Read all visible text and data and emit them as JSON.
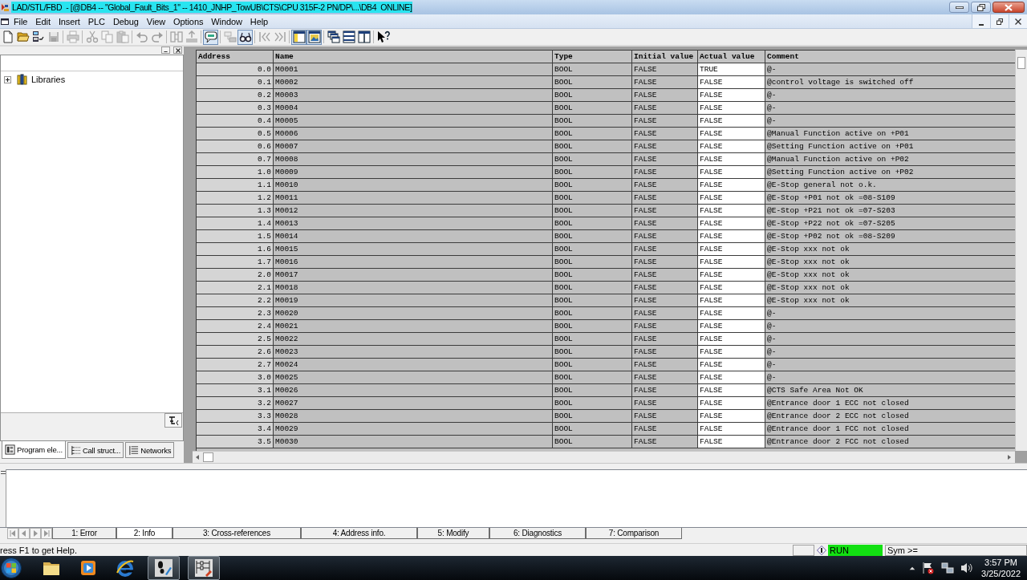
{
  "window": {
    "title": "LAD/STL/FBD  - [@DB4 -- \"Global_Fault_Bits_1\" -- 1410_JNHP_TowUB\\CTS\\CPU 315F-2 PN/DP\\...\\DB4  ONLINE]"
  },
  "menu": [
    "File",
    "Edit",
    "Insert",
    "PLC",
    "Debug",
    "View",
    "Options",
    "Window",
    "Help"
  ],
  "toolbar": {
    "groups": [
      [
        {
          "kind": "new",
          "disabled": false,
          "pressed": false
        },
        {
          "kind": "open",
          "disabled": false,
          "pressed": false
        },
        {
          "kind": "nodes",
          "disabled": false,
          "pressed": false
        },
        {
          "kind": "save",
          "disabled": true,
          "pressed": false
        }
      ],
      [
        {
          "kind": "print",
          "disabled": true,
          "pressed": false
        }
      ],
      [
        {
          "kind": "cut",
          "disabled": true,
          "pressed": false
        },
        {
          "kind": "copy",
          "disabled": true,
          "pressed": false
        },
        {
          "kind": "paste",
          "disabled": true,
          "pressed": false
        }
      ],
      [
        {
          "kind": "undo",
          "disabled": true,
          "pressed": false
        },
        {
          "kind": "redo",
          "disabled": true,
          "pressed": false
        }
      ],
      [
        {
          "kind": "blocks",
          "disabled": true,
          "pressed": false
        },
        {
          "kind": "load",
          "disabled": true,
          "pressed": false
        }
      ],
      [
        {
          "kind": "bubble",
          "disabled": false,
          "pressed": true
        }
      ],
      [
        {
          "kind": "stacked",
          "disabled": true,
          "pressed": false
        },
        {
          "kind": "glasses",
          "disabled": false,
          "pressed": true
        }
      ],
      [
        {
          "kind": "skip_back",
          "disabled": true,
          "pressed": false
        },
        {
          "kind": "skip_forward",
          "disabled": true,
          "pressed": false
        }
      ],
      [
        {
          "kind": "layout",
          "disabled": false,
          "pressed": true
        },
        {
          "kind": "picture",
          "disabled": false,
          "pressed": true
        }
      ],
      [
        {
          "kind": "cascade",
          "disabled": false,
          "pressed": false
        },
        {
          "kind": "tile_h",
          "disabled": false,
          "pressed": false
        },
        {
          "kind": "tile_v",
          "disabled": false,
          "pressed": false
        }
      ],
      [
        {
          "kind": "help",
          "disabled": false,
          "pressed": false
        }
      ]
    ]
  },
  "explorer": {
    "tree": [
      {
        "label": "Libraries",
        "expanded": false
      }
    ],
    "tabs": [
      {
        "label": "Program ele...",
        "kind": "program",
        "selected": true
      },
      {
        "label": "Call struct...",
        "kind": "call",
        "selected": false
      },
      {
        "label": "Networks",
        "kind": "networks",
        "selected": false
      }
    ]
  },
  "table": {
    "columns": [
      "Address",
      "Name",
      "Type",
      "Initial value",
      "Actual value",
      "Comment"
    ],
    "rows": [
      {
        "address": "0.0",
        "name": "M0001",
        "type": "BOOL",
        "initial_value": "FALSE",
        "actual_value": "TRUE",
        "comment": "@-"
      },
      {
        "address": "0.1",
        "name": "M0002",
        "type": "BOOL",
        "initial_value": "FALSE",
        "actual_value": "FALSE",
        "comment": "@control voltage is switched off"
      },
      {
        "address": "0.2",
        "name": "M0003",
        "type": "BOOL",
        "initial_value": "FALSE",
        "actual_value": "FALSE",
        "comment": "@-"
      },
      {
        "address": "0.3",
        "name": "M0004",
        "type": "BOOL",
        "initial_value": "FALSE",
        "actual_value": "FALSE",
        "comment": "@-"
      },
      {
        "address": "0.4",
        "name": "M0005",
        "type": "BOOL",
        "initial_value": "FALSE",
        "actual_value": "FALSE",
        "comment": "@-"
      },
      {
        "address": "0.5",
        "name": "M0006",
        "type": "BOOL",
        "initial_value": "FALSE",
        "actual_value": "FALSE",
        "comment": "@Manual Function active on +P01"
      },
      {
        "address": "0.6",
        "name": "M0007",
        "type": "BOOL",
        "initial_value": "FALSE",
        "actual_value": "FALSE",
        "comment": "@Setting Function active on +P01"
      },
      {
        "address": "0.7",
        "name": "M0008",
        "type": "BOOL",
        "initial_value": "FALSE",
        "actual_value": "FALSE",
        "comment": "@Manual Function active on +P02"
      },
      {
        "address": "1.0",
        "name": "M0009",
        "type": "BOOL",
        "initial_value": "FALSE",
        "actual_value": "FALSE",
        "comment": "@Setting Function active on +P02"
      },
      {
        "address": "1.1",
        "name": "M0010",
        "type": "BOOL",
        "initial_value": "FALSE",
        "actual_value": "FALSE",
        "comment": "@E-Stop general not o.k."
      },
      {
        "address": "1.2",
        "name": "M0011",
        "type": "BOOL",
        "initial_value": "FALSE",
        "actual_value": "FALSE",
        "comment": "@E-Stop +P01 not ok =08-S109"
      },
      {
        "address": "1.3",
        "name": "M0012",
        "type": "BOOL",
        "initial_value": "FALSE",
        "actual_value": "FALSE",
        "comment": "@E-Stop +P21 not ok =07-S203"
      },
      {
        "address": "1.4",
        "name": "M0013",
        "type": "BOOL",
        "initial_value": "FALSE",
        "actual_value": "FALSE",
        "comment": "@E-Stop +P22 not ok =07-S205"
      },
      {
        "address": "1.5",
        "name": "M0014",
        "type": "BOOL",
        "initial_value": "FALSE",
        "actual_value": "FALSE",
        "comment": "@E-Stop +P02 not ok =08-S209"
      },
      {
        "address": "1.6",
        "name": "M0015",
        "type": "BOOL",
        "initial_value": "FALSE",
        "actual_value": "FALSE",
        "comment": "@E-Stop xxx not ok"
      },
      {
        "address": "1.7",
        "name": "M0016",
        "type": "BOOL",
        "initial_value": "FALSE",
        "actual_value": "FALSE",
        "comment": "@E-Stop xxx not ok"
      },
      {
        "address": "2.0",
        "name": "M0017",
        "type": "BOOL",
        "initial_value": "FALSE",
        "actual_value": "FALSE",
        "comment": "@E-Stop xxx not ok"
      },
      {
        "address": "2.1",
        "name": "M0018",
        "type": "BOOL",
        "initial_value": "FALSE",
        "actual_value": "FALSE",
        "comment": "@E-Stop xxx not ok"
      },
      {
        "address": "2.2",
        "name": "M0019",
        "type": "BOOL",
        "initial_value": "FALSE",
        "actual_value": "FALSE",
        "comment": "@E-Stop xxx not ok"
      },
      {
        "address": "2.3",
        "name": "M0020",
        "type": "BOOL",
        "initial_value": "FALSE",
        "actual_value": "FALSE",
        "comment": "@-"
      },
      {
        "address": "2.4",
        "name": "M0021",
        "type": "BOOL",
        "initial_value": "FALSE",
        "actual_value": "FALSE",
        "comment": "@-"
      },
      {
        "address": "2.5",
        "name": "M0022",
        "type": "BOOL",
        "initial_value": "FALSE",
        "actual_value": "FALSE",
        "comment": "@-"
      },
      {
        "address": "2.6",
        "name": "M0023",
        "type": "BOOL",
        "initial_value": "FALSE",
        "actual_value": "FALSE",
        "comment": "@-"
      },
      {
        "address": "2.7",
        "name": "M0024",
        "type": "BOOL",
        "initial_value": "FALSE",
        "actual_value": "FALSE",
        "comment": "@-"
      },
      {
        "address": "3.0",
        "name": "M0025",
        "type": "BOOL",
        "initial_value": "FALSE",
        "actual_value": "FALSE",
        "comment": "@-"
      },
      {
        "address": "3.1",
        "name": "M0026",
        "type": "BOOL",
        "initial_value": "FALSE",
        "actual_value": "FALSE",
        "comment": "@CTS Safe Area Not OK"
      },
      {
        "address": "3.2",
        "name": "M0027",
        "type": "BOOL",
        "initial_value": "FALSE",
        "actual_value": "FALSE",
        "comment": "@Entrance door 1 ECC not closed"
      },
      {
        "address": "3.3",
        "name": "M0028",
        "type": "BOOL",
        "initial_value": "FALSE",
        "actual_value": "FALSE",
        "comment": "@Entrance door 2 ECC not closed"
      },
      {
        "address": "3.4",
        "name": "M0029",
        "type": "BOOL",
        "initial_value": "FALSE",
        "actual_value": "FALSE",
        "comment": "@Entrance door 1 FCC not closed"
      },
      {
        "address": "3.5",
        "name": "M0030",
        "type": "BOOL",
        "initial_value": "FALSE",
        "actual_value": "FALSE",
        "comment": "@Entrance door 2 FCC not closed"
      }
    ]
  },
  "output_panel": {
    "tabs": [
      {
        "label": "1: Error",
        "selected": false
      },
      {
        "label": "2: Info",
        "selected": true
      },
      {
        "label": "3: Cross-references",
        "selected": false
      },
      {
        "label": "4: Address info.",
        "selected": false
      },
      {
        "label": "5: Modify",
        "selected": false
      },
      {
        "label": "6: Diagnostics",
        "selected": false
      },
      {
        "label": "7: Comparison",
        "selected": false
      }
    ]
  },
  "status_bar": {
    "help": "ress F1 to get Help.",
    "mode": "RUN",
    "symbol": "Sym >="
  },
  "taskbar": {
    "apps": [
      {
        "kind": "folder",
        "running": false
      },
      {
        "kind": "media",
        "running": false
      },
      {
        "kind": "browser",
        "running": false
      },
      {
        "kind": "feet",
        "running": true
      },
      {
        "kind": "ladder",
        "running": true
      }
    ],
    "time": "3:57 PM",
    "date": "3/25/2022"
  }
}
